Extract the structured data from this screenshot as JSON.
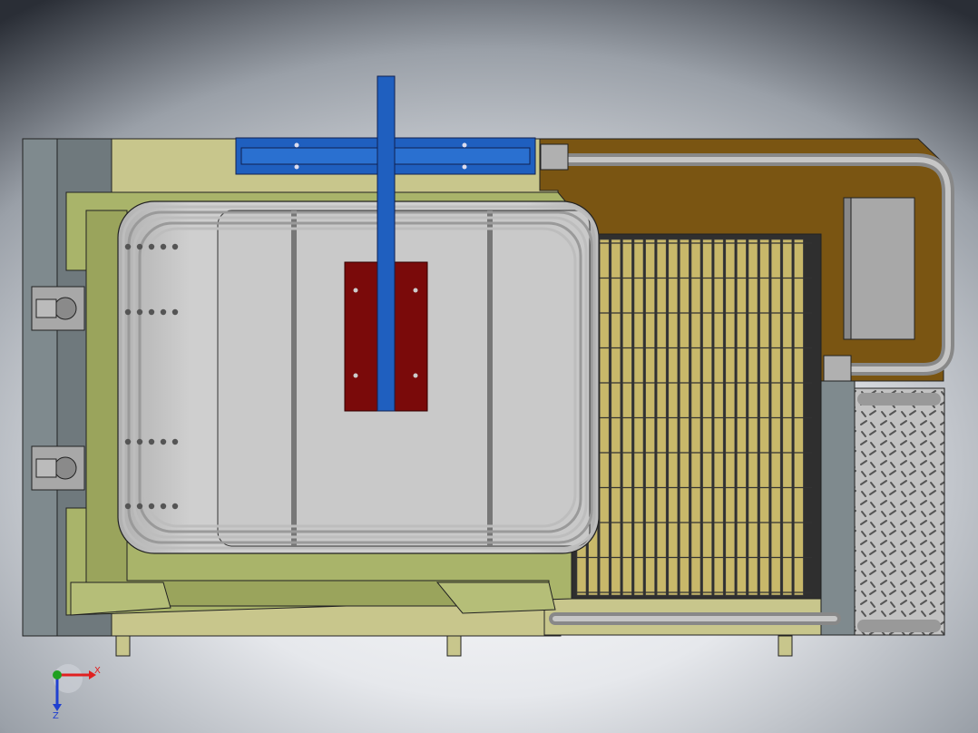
{
  "view": {
    "title": "",
    "background_top": "#2a2e36",
    "background_bottom": "#ffffff"
  },
  "model": {
    "colors": {
      "base_frame": "#c8c68c",
      "deck": "#a9b46a",
      "orange_deck": "#7a5512",
      "tank": "#c4c4c4",
      "rails": "#a8a8a8",
      "blue_beam": "#1f5fbf",
      "red_plate": "#7a0a0a",
      "grating": "#c8b86a",
      "checker_plate": "#bdbdbd"
    }
  },
  "triad": {
    "x_label": "X",
    "z_label": "Z",
    "x_color": "#e02020",
    "y_color": "#20a020",
    "z_color": "#2040d0"
  }
}
